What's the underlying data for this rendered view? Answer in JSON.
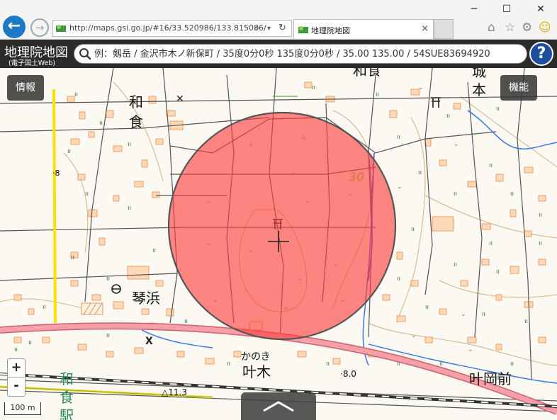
{
  "browser": {
    "url": "http://maps.gsi.go.jp/#16/33.520986/133.815086/",
    "tab_title": "地理院地図",
    "tab_close": "×",
    "minimize": "─",
    "maximize": "☐",
    "close": "✕",
    "back_icon": "back-arrow-icon",
    "forward_icon": "forward-arrow-icon"
  },
  "header": {
    "logo": "地理院地図",
    "logo_sub": "(電子国土Web)",
    "search_placeholder": "例：剱岳 / 金沢市木ノ新保町 / 35度0分0秒 135度0分0秒 / 35.00 135.00 / 54SUE83694920",
    "help_label": "?"
  },
  "map": {
    "info_button": "情報",
    "function_button": "機能",
    "zoom_in": "+",
    "zoom_out": "-",
    "scale": "100 m",
    "circle_color": "#ff3b3b",
    "labels": {
      "wajiki_top": "和食",
      "wajiki_left_1": "和",
      "wajiki_left_2": "食",
      "jo": "城",
      "moto": "本",
      "kotohama": "琴浜",
      "kanoki_kana": "かのき",
      "kanoki": "叶木",
      "kanooka": "叶岡前",
      "contour_30": "30",
      "elev_11": "△11.3",
      "elev_8": "·8",
      "elev_8_0": "·8.0",
      "station_1": "和",
      "station_2": "食",
      "station_3": "駅"
    }
  }
}
